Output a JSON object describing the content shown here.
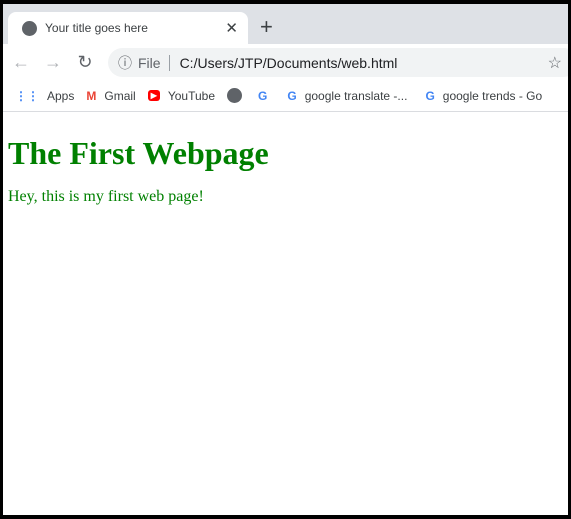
{
  "tab": {
    "title": "Your title goes here",
    "icon": "globe-icon"
  },
  "toolbar": {
    "scheme": "File",
    "url": "C:/Users/JTP/Documents/web.html"
  },
  "bookmarks": [
    {
      "label": "Apps",
      "icon": "apps-grid-icon"
    },
    {
      "label": "Gmail",
      "icon": "gmail-icon"
    },
    {
      "label": "YouTube",
      "icon": "youtube-icon"
    },
    {
      "label": "",
      "icon": "globe-icon"
    },
    {
      "label": "",
      "icon": "google-icon"
    },
    {
      "label": "google translate -...",
      "icon": "google-icon"
    },
    {
      "label": "google trends - Go",
      "icon": "google-icon"
    }
  ],
  "page": {
    "heading": "The First Webpage",
    "paragraph": "Hey, this is my first web page!",
    "text_color": "#008000"
  }
}
